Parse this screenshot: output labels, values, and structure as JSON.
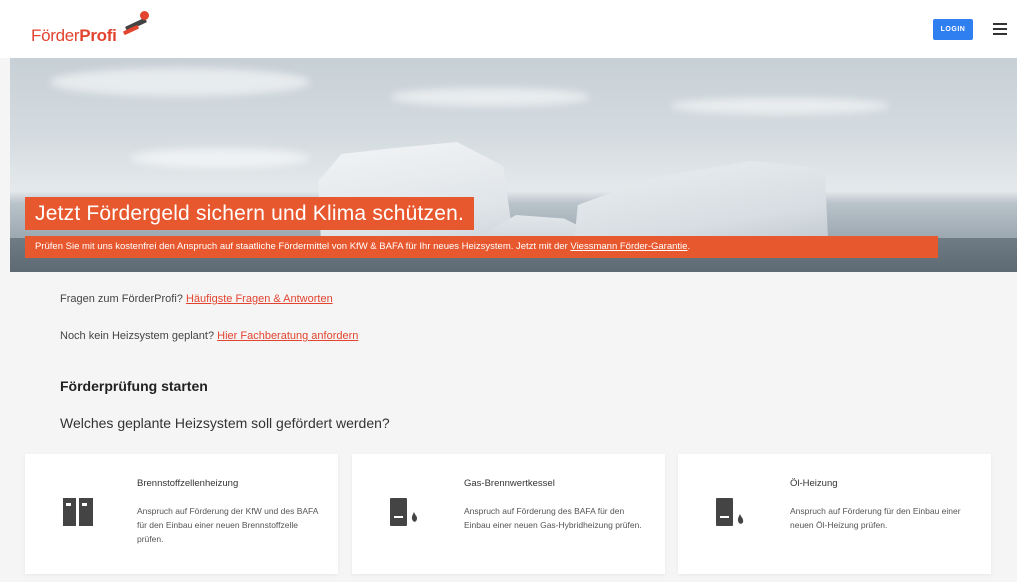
{
  "header": {
    "logo_part1": "Förder",
    "logo_part2": "Profi",
    "login_label": "LOGIN"
  },
  "hero": {
    "title": "Jetzt Fördergeld sichern und Klima schützen.",
    "subtitle_text": "Prüfen Sie mit uns kostenfrei den Anspruch auf staatliche Fördermittel von KfW & BAFA für Ihr neues Heizsystem. Jetzt mit der ",
    "subtitle_link": "Viessmann Förder-Garantie",
    "subtitle_end": "."
  },
  "faq": {
    "q1_text": "Fragen zum FörderProfi? ",
    "q1_link": "Häufigste Fragen & Antworten",
    "q2_text": "Noch kein Heizsystem geplant? ",
    "q2_link": "Hier Fachberatung anfordern"
  },
  "section_title": "Förderprüfung starten",
  "question": "Welches geplante Heizsystem soll gefördert werden?",
  "cards": [
    {
      "title": "Brennstoffzellenheizung",
      "description": "Anspruch auf Förderung der KfW und des BAFA für den Einbau einer neuen Brennstoffzelle prüfen.",
      "icon": "fuel-cell-icon"
    },
    {
      "title": "Gas-Brennwertkessel",
      "description": "Anspruch auf Förderung des BAFA für den Einbau einer neuen Gas-Hybridheizung prüfen.",
      "icon": "gas-boiler-icon"
    },
    {
      "title": "Öl-Heizung",
      "description": "Anspruch auf Förderung für den Einbau einer neuen Öl-Heizung prüfen.",
      "icon": "oil-boiler-icon"
    }
  ],
  "colors": {
    "brand_orange": "#e8582f",
    "login_blue": "#2f7ff0"
  }
}
